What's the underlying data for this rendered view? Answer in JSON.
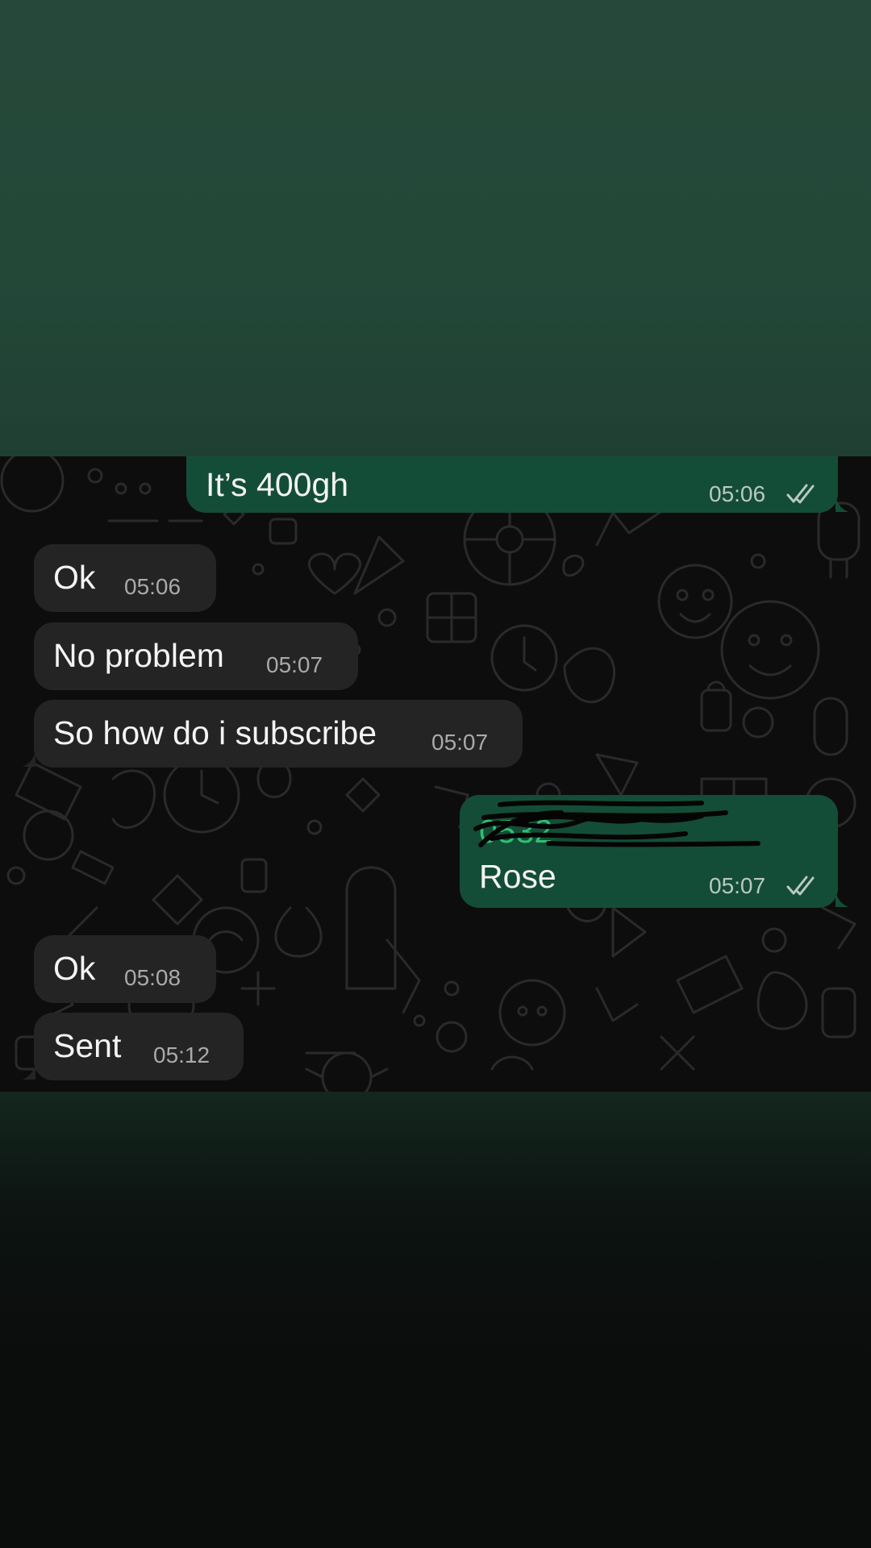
{
  "chat": {
    "messages": [
      {
        "direction": "outgoing",
        "text": "It’s 400gh",
        "time": "05:06",
        "status": "read-double-tick-icon"
      },
      {
        "direction": "incoming",
        "text": "Ok",
        "time": "05:06"
      },
      {
        "direction": "incoming",
        "text": "No problem",
        "time": "05:07"
      },
      {
        "direction": "incoming",
        "text": "So how do i subscribe",
        "time": "05:07"
      },
      {
        "direction": "outgoing",
        "redacted_line": "0532",
        "text": "Rose",
        "time": "05:07",
        "status": "read-double-tick-icon"
      },
      {
        "direction": "incoming",
        "text": "Ok",
        "time": "05:08"
      },
      {
        "direction": "incoming",
        "text": "Sent",
        "time": "05:12"
      }
    ]
  },
  "colors": {
    "incoming_bubble": "#242424",
    "outgoing_bubble": "#144d37",
    "chat_background": "#0d0d0d",
    "top_band": "#26483a",
    "time_text": "#a9aaa9",
    "link_green": "#2fbf73"
  }
}
